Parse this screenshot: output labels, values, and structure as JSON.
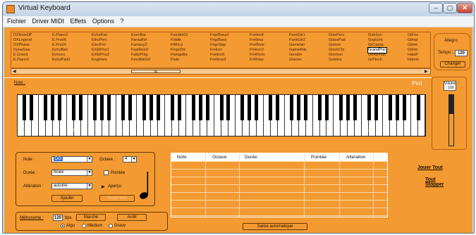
{
  "window": {
    "title": "Virtual Keyboard",
    "min": "–",
    "max": "▢",
    "close": "✕"
  },
  "menu": [
    "Fichier",
    "Driver MIDI",
    "Effets",
    "Options",
    "?"
  ],
  "instruments": [
    [
      "DXKotoDP",
      "DXLegend",
      "DXPhase",
      "DynaSaw",
      "E.Grand",
      "E.Piano1"
    ],
    [
      "E.Piano2",
      "E.PnoIK",
      "E.PnoIX",
      "EchoBell",
      "Echoes",
      "EchoPad2"
    ],
    [
      "EchoPan",
      "ElecPerc",
      "ElecPno",
      "EXElPno1",
      "EXElPno2",
      "EngHorn"
    ],
    [
      "EvenBar",
      "FantaBel",
      "Fantasy2",
      "FastResD",
      "FattyPrkg",
      "FeedbkGt2"
    ],
    [
      "FeedbkGt",
      "Fiddle",
      "FifthLd",
      "FingrDrk",
      "FlangeBa",
      "Flute"
    ],
    [
      "FngrBass2",
      "FngrBass",
      "FngrSlap",
      "FrHorn",
      "FretlesS",
      "Fretless3"
    ],
    [
      "Fretles4",
      "Fretless",
      "FretNsie",
      "FrHorn2",
      "FrHtSolo",
      "FrtRotar"
    ],
    [
      "FunkGtr1",
      "FunkGtr2",
      "Gamelan",
      "Gamelthls",
      "Gender",
      "Glacier"
    ],
    [
      "GlasPerc",
      "GlassPad",
      "Glstom",
      "GlockChi",
      "Glocken",
      "Goblins"
    ],
    [
      "GobSyn",
      "Gopicint",
      "GrCassa",
      "GrandPno",
      "GrndPnoK",
      "GrPinch"
    ],
    [
      "GtFee",
      "GtHar",
      "GtHm",
      "GtHm",
      "HaloP",
      "Hamm"
    ]
  ],
  "selected_instrument": "GrandPno",
  "scroll": {
    "position": "III"
  },
  "tempo": {
    "title": "Allegro",
    "label": "Tempo :",
    "value": "120",
    "button": "Changer"
  },
  "note_label": "Note :",
  "pedal_label": "Ped",
  "volume": {
    "label": "Volume : 100",
    "level": 0.62
  },
  "keyboard": {
    "octaves": [
      "0",
      "1",
      "2",
      "3",
      "4",
      "5",
      "6",
      "7"
    ]
  },
  "form": {
    "note_label": "Note :",
    "note_value": "DO",
    "octave_label": "Octave :",
    "octave_value": "4",
    "duree_label": "Durée :",
    "duree_value": "Noire",
    "pointee_label": "Pointée",
    "alteration_label": "Altération :",
    "alteration_value": "aucune",
    "apercu_label": "Aperçu",
    "ajouter_label": "Ajouter",
    "supprimer_label": "Supprimer"
  },
  "table": {
    "headers": [
      "Note",
      "Octave",
      "Durée",
      "Pointée",
      "Alteration"
    ]
  },
  "actions": {
    "jouer_tout": "Jouer Tout",
    "tout_stopper": "Tout Stopper",
    "saisie": "Saisie automatique"
  },
  "metronome": {
    "label": "Métronome :",
    "value": "120",
    "unit": "bps",
    "marche": "Marche",
    "arret": "Arrêt",
    "radios": [
      "Aigu",
      "Médium",
      "Grave"
    ],
    "selected": "Aigu"
  },
  "colors": {
    "accent": "#f39a32",
    "dark": "#6b3a00"
  }
}
